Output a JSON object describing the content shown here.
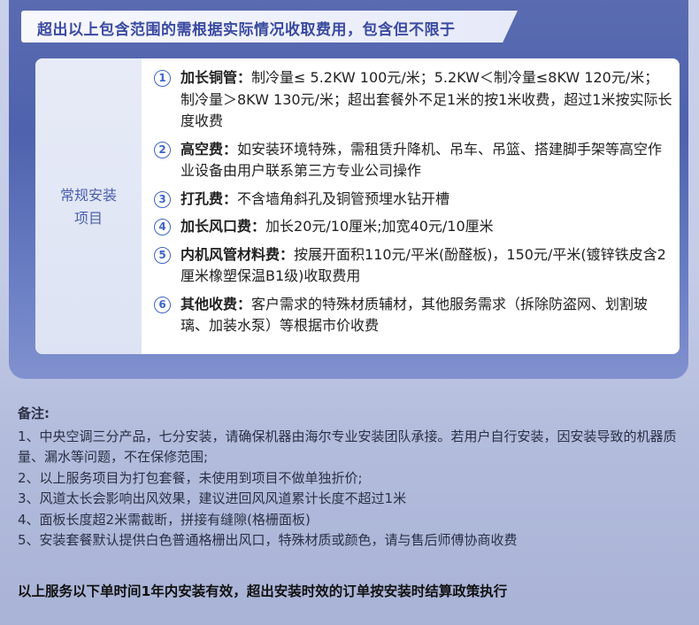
{
  "banner": "超出以上包含范围的需根据实际情况收取费用，包含但不限于",
  "category": [
    "常规安装",
    "项目"
  ],
  "items": [
    {
      "num": "1",
      "label": "加长铜管：",
      "text": "制冷量≤ 5.2KW 100元/米；5.2KW＜制冷量≤8KW 120元/米；制冷量＞8KW 130元/米；超出套餐外不足1米的按1米收费，超过1米按实际长度收费"
    },
    {
      "num": "2",
      "label": "高空费：",
      "text": "如安装环境特殊，需租赁升降机、吊车、吊篮、搭建脚手架等高空作业设备由用户联系第三方专业公司操作"
    },
    {
      "num": "3",
      "label": "打孔费：",
      "text": "不含墙角斜孔及铜管预埋水钻开槽"
    },
    {
      "num": "4",
      "label": "加长风口费：",
      "text": "加长20元/10厘米;加宽40元/10厘米"
    },
    {
      "num": "5",
      "label": "内机风管材料费：",
      "text": "按展开面积110元/平米(酚醛板)，150元/平米(镀锌铁皮含2厘米橡塑保温B1级)收取费用"
    },
    {
      "num": "6",
      "label": "其他收费：",
      "text": "客户需求的特殊材质辅材，其他服务需求（拆除防盗网、划割玻璃、加装水泵）等根据市价收费"
    }
  ],
  "notes": {
    "title": "备注:",
    "lines": [
      "1、中央空调三分产品，七分安装，请确保机器由海尔专业安装团队承接。若用户自行安装，因安装导致的机器质量、漏水等问题，不在保修范围;",
      "2、以上服务项目为打包套餐，未使用到项目不做单独折价;",
      "3、风道太长会影响出风效果，建议进回风风道累计长度不超过1米",
      "4、面板长度超2米需截断，拼接有缝隙(格栅面板)",
      "5、安装套餐默认提供白色普通格栅出风口，特殊材质或颜色，请与售后师傅协商收费"
    ]
  },
  "footer": "以上服务以下单时间1年内安装有效，超出安装时效的订单按安装时结算政策执行"
}
